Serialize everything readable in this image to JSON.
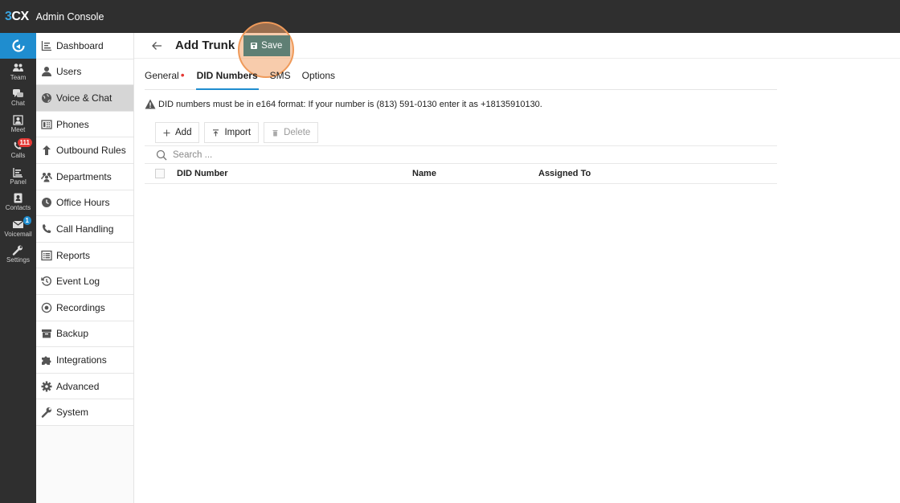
{
  "app": {
    "logo_prefix": "3",
    "logo_suffix": "CX",
    "title": "Admin Console"
  },
  "rail": {
    "items": [
      {
        "label": "Team",
        "icon": "team-icon"
      },
      {
        "label": "Chat",
        "icon": "chat-icon"
      },
      {
        "label": "Meet",
        "icon": "meet-icon"
      },
      {
        "label": "Calls",
        "icon": "calls-icon",
        "badge": "111"
      },
      {
        "label": "Panel",
        "icon": "panel-icon"
      },
      {
        "label": "Contacts",
        "icon": "contacts-icon"
      },
      {
        "label": "Voicemail",
        "icon": "voicemail-icon",
        "badge": "1"
      },
      {
        "label": "Settings",
        "icon": "settings-icon"
      }
    ]
  },
  "sidebar": {
    "items": [
      {
        "label": "Dashboard",
        "icon": "dashboard-icon"
      },
      {
        "label": "Users",
        "icon": "user-icon"
      },
      {
        "label": "Voice & Chat",
        "icon": "globe-icon",
        "active": true
      },
      {
        "label": "Phones",
        "icon": "phone-device-icon"
      },
      {
        "label": "Outbound Rules",
        "icon": "arrow-up-icon"
      },
      {
        "label": "Departments",
        "icon": "departments-icon"
      },
      {
        "label": "Office Hours",
        "icon": "clock-icon"
      },
      {
        "label": "Call Handling",
        "icon": "handset-icon"
      },
      {
        "label": "Reports",
        "icon": "reports-icon"
      },
      {
        "label": "Event Log",
        "icon": "history-icon"
      },
      {
        "label": "Recordings",
        "icon": "record-icon"
      },
      {
        "label": "Backup",
        "icon": "archive-icon"
      },
      {
        "label": "Integrations",
        "icon": "puzzle-icon"
      },
      {
        "label": "Advanced",
        "icon": "gear-icon"
      },
      {
        "label": "System",
        "icon": "wrench-icon"
      }
    ]
  },
  "header": {
    "title": "Add Trunk",
    "save_label": "Save"
  },
  "tabs": [
    {
      "label": "General",
      "required": true
    },
    {
      "label": "DID Numbers",
      "active": true
    },
    {
      "label": "SMS"
    },
    {
      "label": "Options"
    }
  ],
  "notice": "DID numbers must be in e164 format: If your number is (813) 591-0130 enter it as +18135910130.",
  "toolbar": {
    "add_label": "Add",
    "import_label": "Import",
    "delete_label": "Delete"
  },
  "search": {
    "placeholder": "Search ..."
  },
  "table": {
    "columns": [
      "DID Number",
      "Name",
      "Assigned To"
    ],
    "rows": []
  },
  "colors": {
    "accent": "#1f8dcf",
    "save_button": "#5f7f74",
    "highlight_ring": "#ef9a5a",
    "topbar": "#2f2f2f"
  }
}
